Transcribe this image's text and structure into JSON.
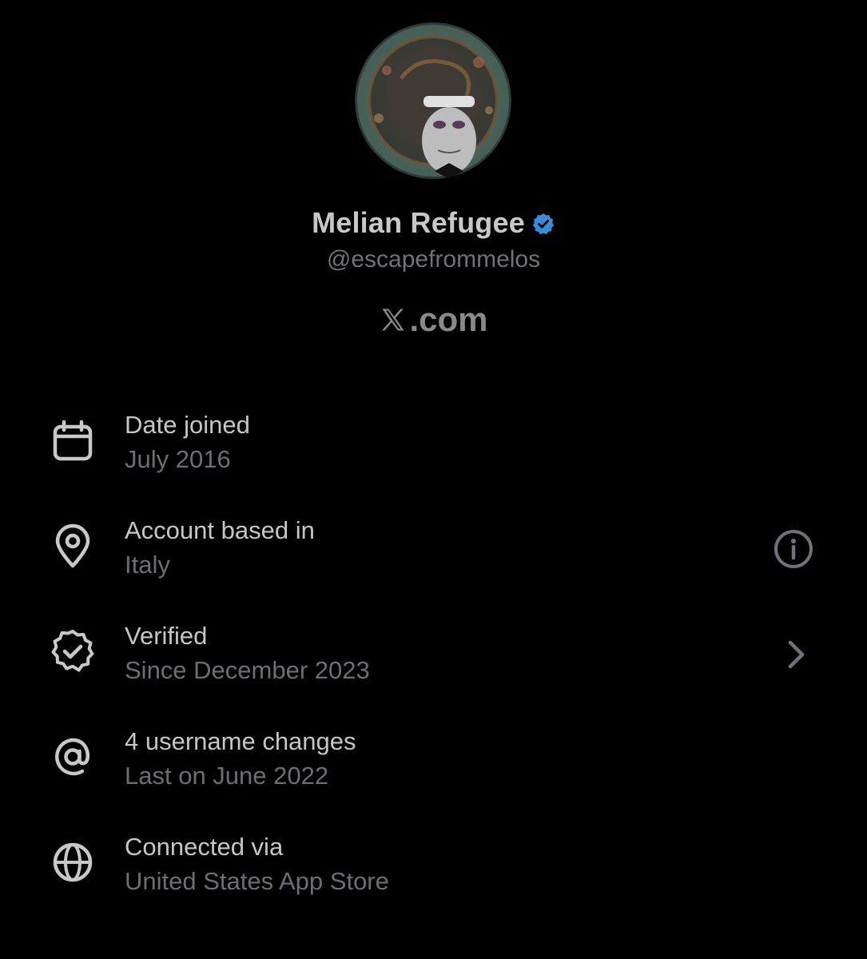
{
  "profile": {
    "display_name": "Melian Refugee",
    "handle": "@escapefrommelos",
    "verified_icon": "verified-badge-icon",
    "avatar_icon": "profile-avatar",
    "brand_text": ".com",
    "brand_icon": "x-logo-icon"
  },
  "info_rows": [
    {
      "label": "Date joined",
      "value": "July 2016",
      "icon": "calendar-icon",
      "trailing": null
    },
    {
      "label": "Account based in",
      "value": "Italy",
      "icon": "location-pin-icon",
      "trailing": "info-icon"
    },
    {
      "label": "Verified",
      "value": "Since December 2023",
      "icon": "verified-check-icon",
      "trailing": "chevron-right-icon"
    },
    {
      "label": "4 username changes",
      "value": "Last on June 2022",
      "icon": "at-sign-icon",
      "trailing": null
    },
    {
      "label": "Connected via",
      "value": "United States App Store",
      "icon": "globe-icon",
      "trailing": null
    }
  ],
  "colors": {
    "background": "#000000",
    "primary_text": "#c8c8c8",
    "secondary_text": "#6e7377",
    "icon": "#c8c8c8",
    "verified_blue": "#3a8ad6"
  }
}
